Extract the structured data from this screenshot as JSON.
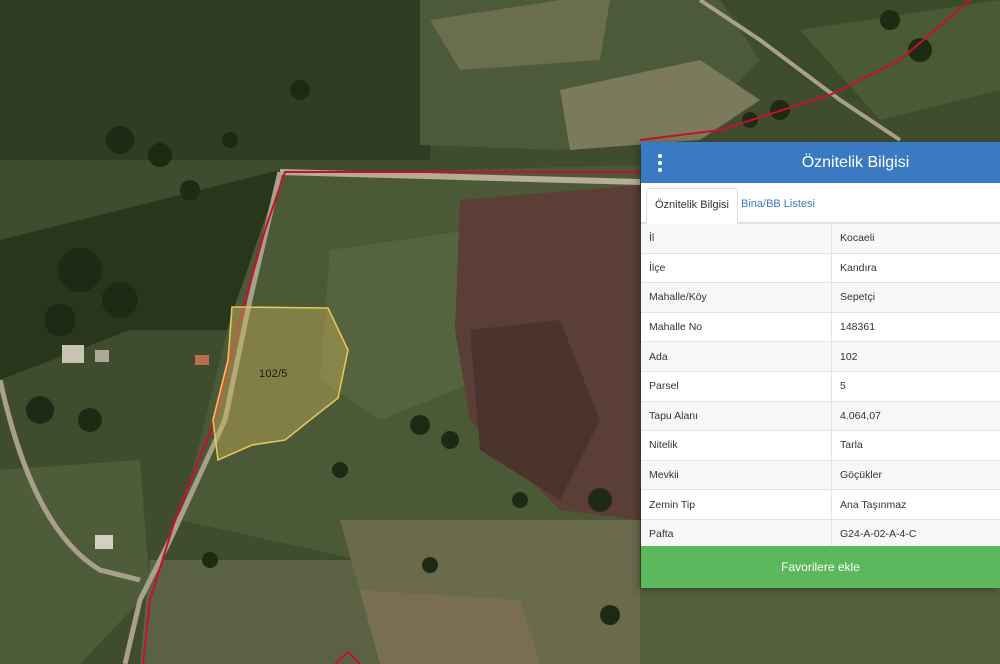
{
  "map": {
    "parcel_label": "102/5"
  },
  "panel": {
    "title": "Öznitelik Bilgisi",
    "tabs": [
      {
        "label": "Öznitelik Bilgisi",
        "active": true
      },
      {
        "label": "Bina/BB Listesi",
        "active": false
      }
    ],
    "rows": [
      {
        "key": "İl",
        "value": "Kocaeli"
      },
      {
        "key": "İlçe",
        "value": "Kandıra"
      },
      {
        "key": "Mahalle/Köy",
        "value": "Sepetçi"
      },
      {
        "key": "Mahalle No",
        "value": "148361"
      },
      {
        "key": "Ada",
        "value": "102"
      },
      {
        "key": "Parsel",
        "value": "5"
      },
      {
        "key": "Tapu Alanı",
        "value": "4.064,07"
      },
      {
        "key": "Nitelik",
        "value": "Tarla"
      },
      {
        "key": "Mevkii",
        "value": "Göçükler"
      },
      {
        "key": "Zemin Tip",
        "value": "Ana Taşınmaz"
      },
      {
        "key": "Pafta",
        "value": "G24-A-02-A-4-C"
      }
    ],
    "favorite_button": "Favorilere ekle"
  },
  "colors": {
    "header": "#3a7ac2",
    "button": "#5cb85c",
    "boundary": "#c8102e",
    "parcel_outline": "#e6c55a"
  }
}
